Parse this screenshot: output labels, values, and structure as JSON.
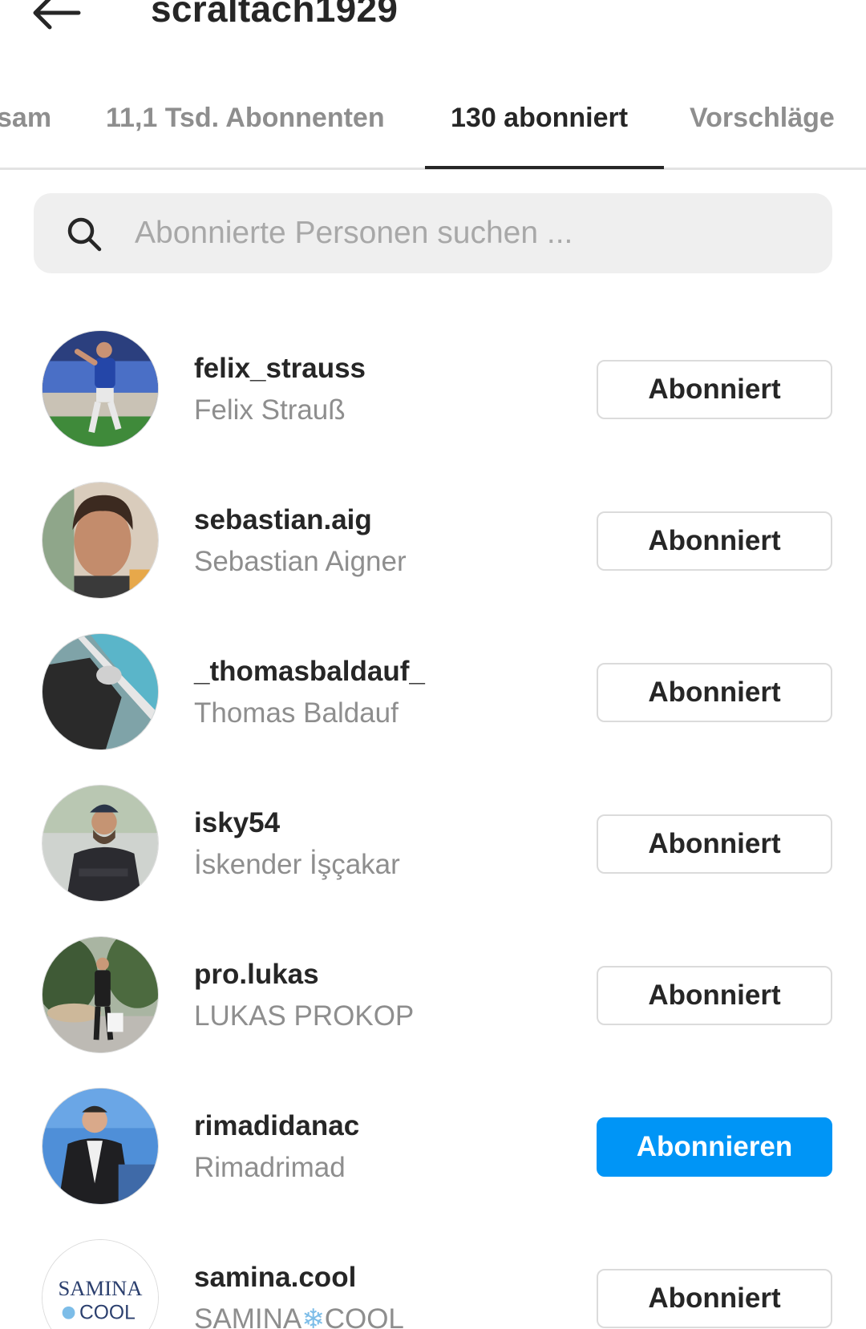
{
  "header": {
    "back_icon": "arrow-left-icon",
    "title": "scraltach1929"
  },
  "tabs": [
    {
      "label": "sam",
      "active": false
    },
    {
      "label": "11,1 Tsd. Abonnenten",
      "active": false
    },
    {
      "label": "130 abonniert",
      "active": true
    },
    {
      "label": "Vorschläge",
      "active": false
    }
  ],
  "search": {
    "icon": "search-icon",
    "placeholder": "Abonnierte Personen suchen ...",
    "value": ""
  },
  "list": [
    {
      "username": "felix_strauss",
      "fullname": "Felix Strauß",
      "button": "Abonniert",
      "following": true
    },
    {
      "username": "sebastian.aig",
      "fullname": "Sebastian Aigner",
      "button": "Abonniert",
      "following": true
    },
    {
      "username": "_thomasbaldauf_",
      "fullname": "Thomas Baldauf",
      "button": "Abonniert",
      "following": true
    },
    {
      "username": "isky54",
      "fullname": "İskender İşçakar",
      "button": "Abonniert",
      "following": true
    },
    {
      "username": "pro.lukas",
      "fullname": "LUKAS PROKOP",
      "button": "Abonniert",
      "following": true
    },
    {
      "username": "rimadidanac",
      "fullname": "Rimadrimad",
      "button": "Abonnieren",
      "following": false
    },
    {
      "username": "samina.cool",
      "fullname_part1": "SAMINA",
      "fullname_part2": "COOL",
      "snowflake": "❄",
      "logo_text_1": "SAMINA",
      "logo_text_2": "COOL",
      "button": "Abonniert",
      "following": true
    }
  ],
  "colors": {
    "primary_button": "#0095f6",
    "secondary_text": "#8e8e8e",
    "border": "#dbdbdb"
  }
}
